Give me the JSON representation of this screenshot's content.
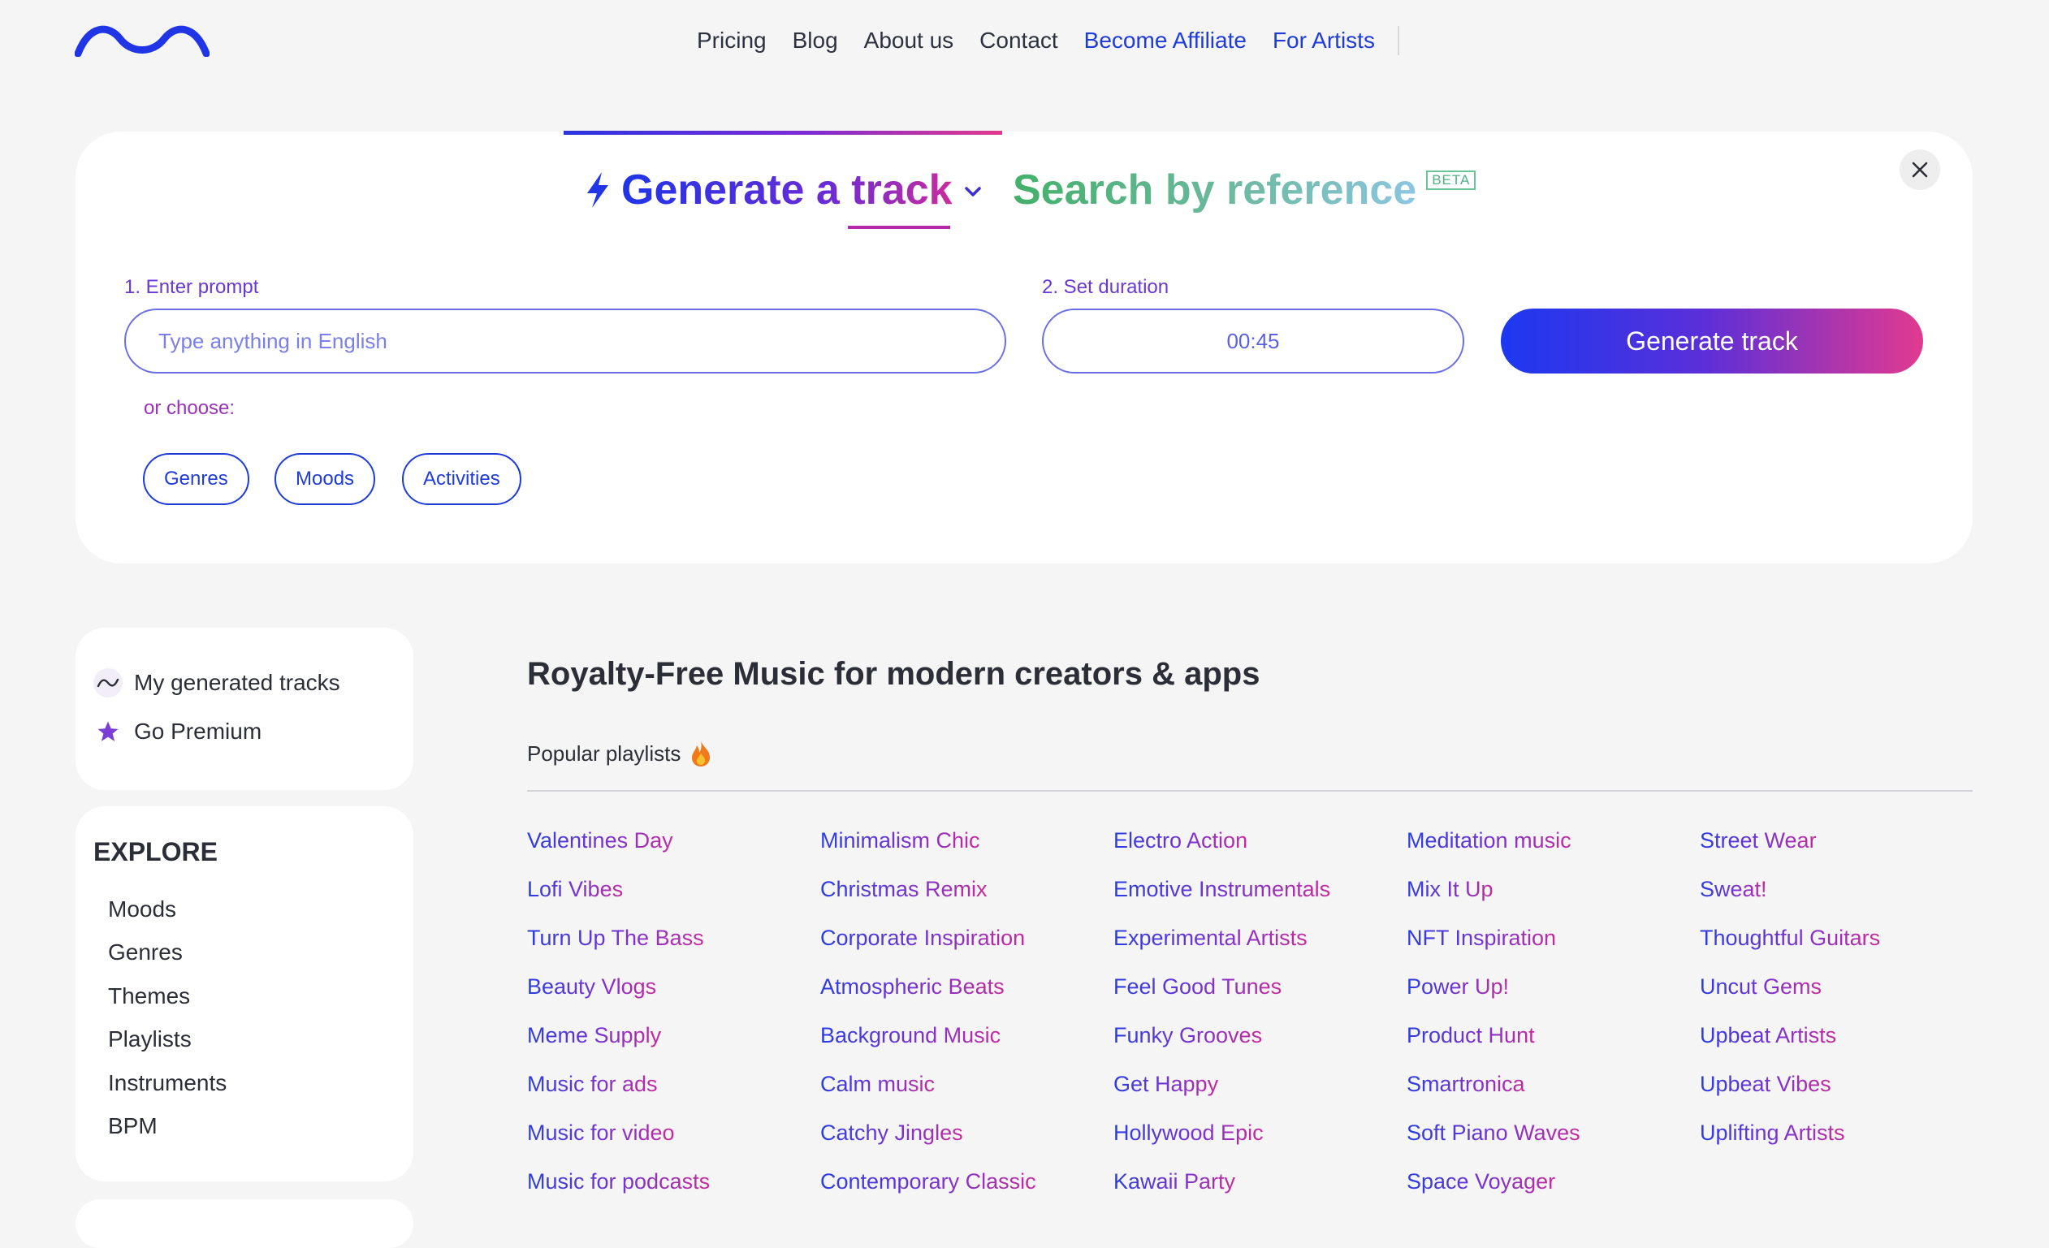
{
  "nav": {
    "links": [
      "Pricing",
      "Blog",
      "About us",
      "Contact",
      "Become Affiliate",
      "For Artists"
    ]
  },
  "generator": {
    "tab_generate_prefix": "Generate a ",
    "tab_generate_word": "track",
    "tab_reference": "Search by reference",
    "beta_badge": "BETA",
    "prompt_label": "1. Enter prompt",
    "prompt_placeholder": "Type anything in English",
    "duration_label": "2. Set duration",
    "duration_value": "00:45",
    "generate_button": "Generate track",
    "or_choose": "or choose:",
    "chips": [
      "Genres",
      "Moods",
      "Activities"
    ]
  },
  "sidebar": {
    "my_tracks": "My generated tracks",
    "go_premium": "Go Premium",
    "explore_title": "EXPLORE",
    "explore_items": [
      "Moods",
      "Genres",
      "Themes",
      "Playlists",
      "Instruments",
      "BPM"
    ]
  },
  "main": {
    "title": "Royalty-Free Music for modern creators & apps",
    "popular_label": "Popular playlists",
    "playlists": [
      [
        "Valentines Day",
        "Lofi Vibes",
        "Turn Up The Bass",
        "Beauty Vlogs",
        "Meme Supply",
        "Music for ads",
        "Music for video",
        "Music for podcasts"
      ],
      [
        "Minimalism Chic",
        "Christmas Remix",
        "Corporate Inspiration",
        "Atmospheric Beats",
        "Background Music",
        "Calm music",
        "Catchy Jingles",
        "Contemporary Classic"
      ],
      [
        "Electro Action",
        "Emotive Instrumentals",
        "Experimental Artists",
        "Feel Good Tunes",
        "Funky Grooves",
        "Get Happy",
        "Hollywood Epic",
        "Kawaii Party"
      ],
      [
        "Meditation music",
        "Mix It Up",
        "NFT Inspiration",
        "Power Up!",
        "Product Hunt",
        "Smartronica",
        "Soft Piano Waves",
        "Space Voyager"
      ],
      [
        "Street Wear",
        "Sweat!",
        "Thoughtful Guitars",
        "Uncut Gems",
        "Upbeat Artists",
        "Upbeat Vibes",
        "Uplifting Artists"
      ]
    ]
  },
  "colors": {
    "brand_blue": "#1f3bd8",
    "accent_pink": "#e23a8f",
    "accent_green": "#43b06a",
    "background": "#f5f5f6"
  },
  "icons": {
    "logo": "wave-logo-icon",
    "generate_tab": "lightning-bolt-icon",
    "dropdown": "chevron-down-icon",
    "close": "close-icon",
    "my_tracks": "wave-icon",
    "premium": "star-icon",
    "popular": "flame-icon"
  }
}
